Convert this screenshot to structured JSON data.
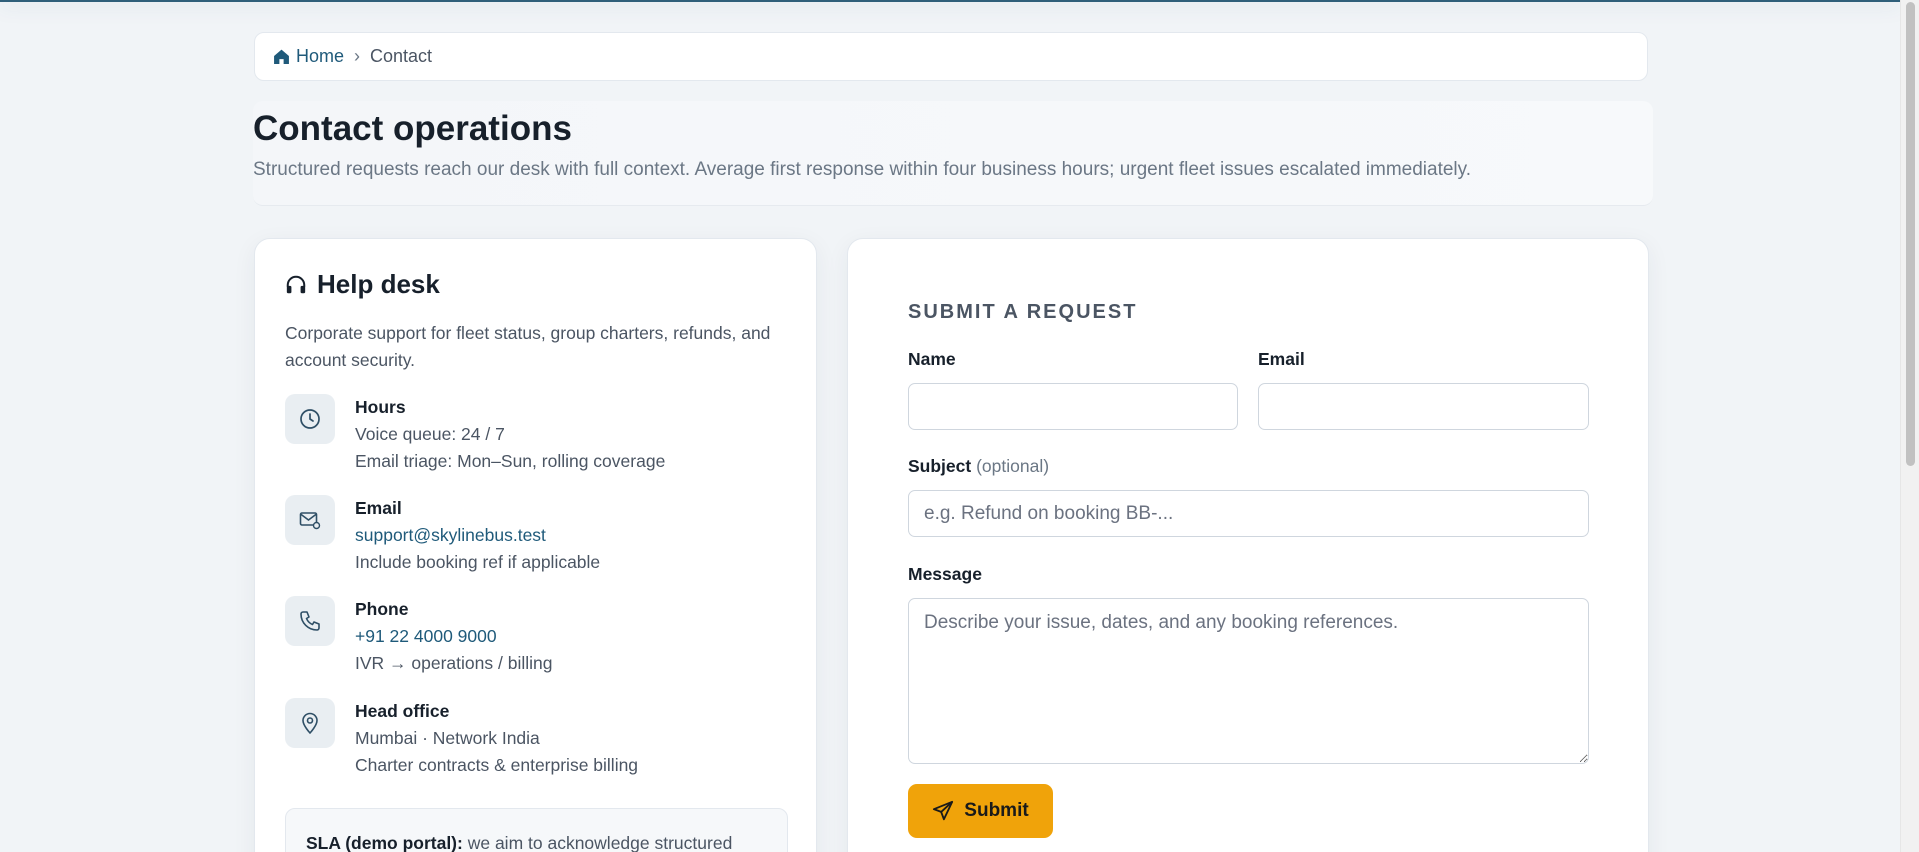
{
  "breadcrumb": {
    "home": "Home",
    "separator": "›",
    "current": "Contact"
  },
  "hero": {
    "title": "Contact operations",
    "subtitle": "Structured requests reach our desk with full context. Average first response within four business hours; urgent fleet issues escalated immediately."
  },
  "helpdesk": {
    "title": "Help desk",
    "description": "Corporate support for fleet status, group charters, refunds, and account security.",
    "hours": {
      "label": "Hours",
      "line1": "Voice queue: 24 / 7",
      "line2": "Email triage: Mon–Sun, rolling coverage"
    },
    "email": {
      "label": "Email",
      "address": "support@skylinebus.test",
      "note": "Include booking ref if applicable"
    },
    "phone": {
      "label": "Phone",
      "number": "+91 22 4000 9000",
      "note": "IVR → operations / billing"
    },
    "office": {
      "label": "Head office",
      "line1": "Mumbai · Network India",
      "line2": "Charter contracts & enterprise billing"
    },
    "sla": {
      "label": "SLA (demo portal):",
      "text": "we aim to acknowledge structured"
    }
  },
  "form": {
    "title": "SUBMIT A REQUEST",
    "name_label": "Name",
    "email_label": "Email",
    "subject_label": "Subject",
    "subject_optional": "(optional)",
    "subject_placeholder": "e.g. Refund on booking BB-...",
    "message_label": "Message",
    "message_placeholder": "Describe your issue, dates, and any booking references.",
    "submit_label": "Submit"
  },
  "colors": {
    "accent": "#f0a30a",
    "link": "#1f5a7a",
    "background": "#f1f4f7"
  }
}
